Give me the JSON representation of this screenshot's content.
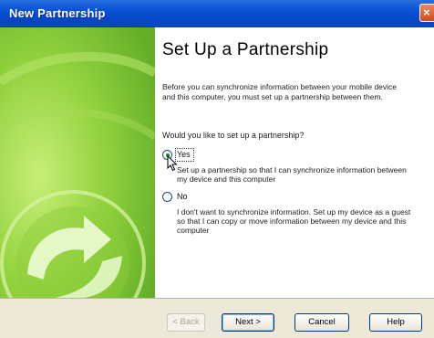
{
  "window": {
    "title": "New Partnership"
  },
  "page": {
    "heading": "Set Up a Partnership",
    "intro": "Before you can synchronize information between your mobile device and this computer, you must set up a partnership between them.",
    "question": "Would you like to set up a partnership?"
  },
  "options": {
    "yes": {
      "label": "Yes",
      "description": "Set up a partnership so that I can synchronize information between my device and this computer",
      "selected": true
    },
    "no": {
      "label": "No",
      "description": "I don't want to synchronize information. Set up my device as a guest so that I can copy or move information between my device and this computer",
      "selected": false
    }
  },
  "buttons": {
    "back": "< Back",
    "next": "Next >",
    "cancel": "Cancel",
    "help": "Help"
  },
  "colors": {
    "titlebar": "#0a55d6",
    "sidebar": "#78c230",
    "footer": "#ece9d8"
  }
}
